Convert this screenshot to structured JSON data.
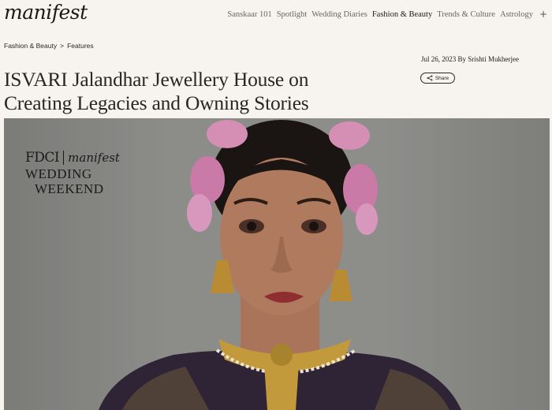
{
  "header": {
    "logo": "manifest",
    "nav": [
      {
        "label": "Sanskaar 101",
        "active": false
      },
      {
        "label": "Spotlight",
        "active": false
      },
      {
        "label": "Wedding Diaries",
        "active": false
      },
      {
        "label": "Fashion & Beauty",
        "active": true
      },
      {
        "label": "Trends & Culture",
        "active": false
      },
      {
        "label": "Astrology",
        "active": false
      }
    ],
    "more_icon": "plus-icon",
    "more_glyph": "+"
  },
  "breadcrumb": {
    "parent": "Fashion & Beauty",
    "separator": ">",
    "current": "Features"
  },
  "article": {
    "title": "ISVARI Jalandhar Jewellery House on Creating Legacies and Owning Stories",
    "date": "Jul 26, 2023",
    "author": "By Srishti Mukherjee",
    "share_label": "Share"
  },
  "hero": {
    "overlay_fdci": "FDCI",
    "overlay_manifest": "manifest",
    "overlay_line1": "WEDDING",
    "overlay_line2": "WEEKEND"
  }
}
